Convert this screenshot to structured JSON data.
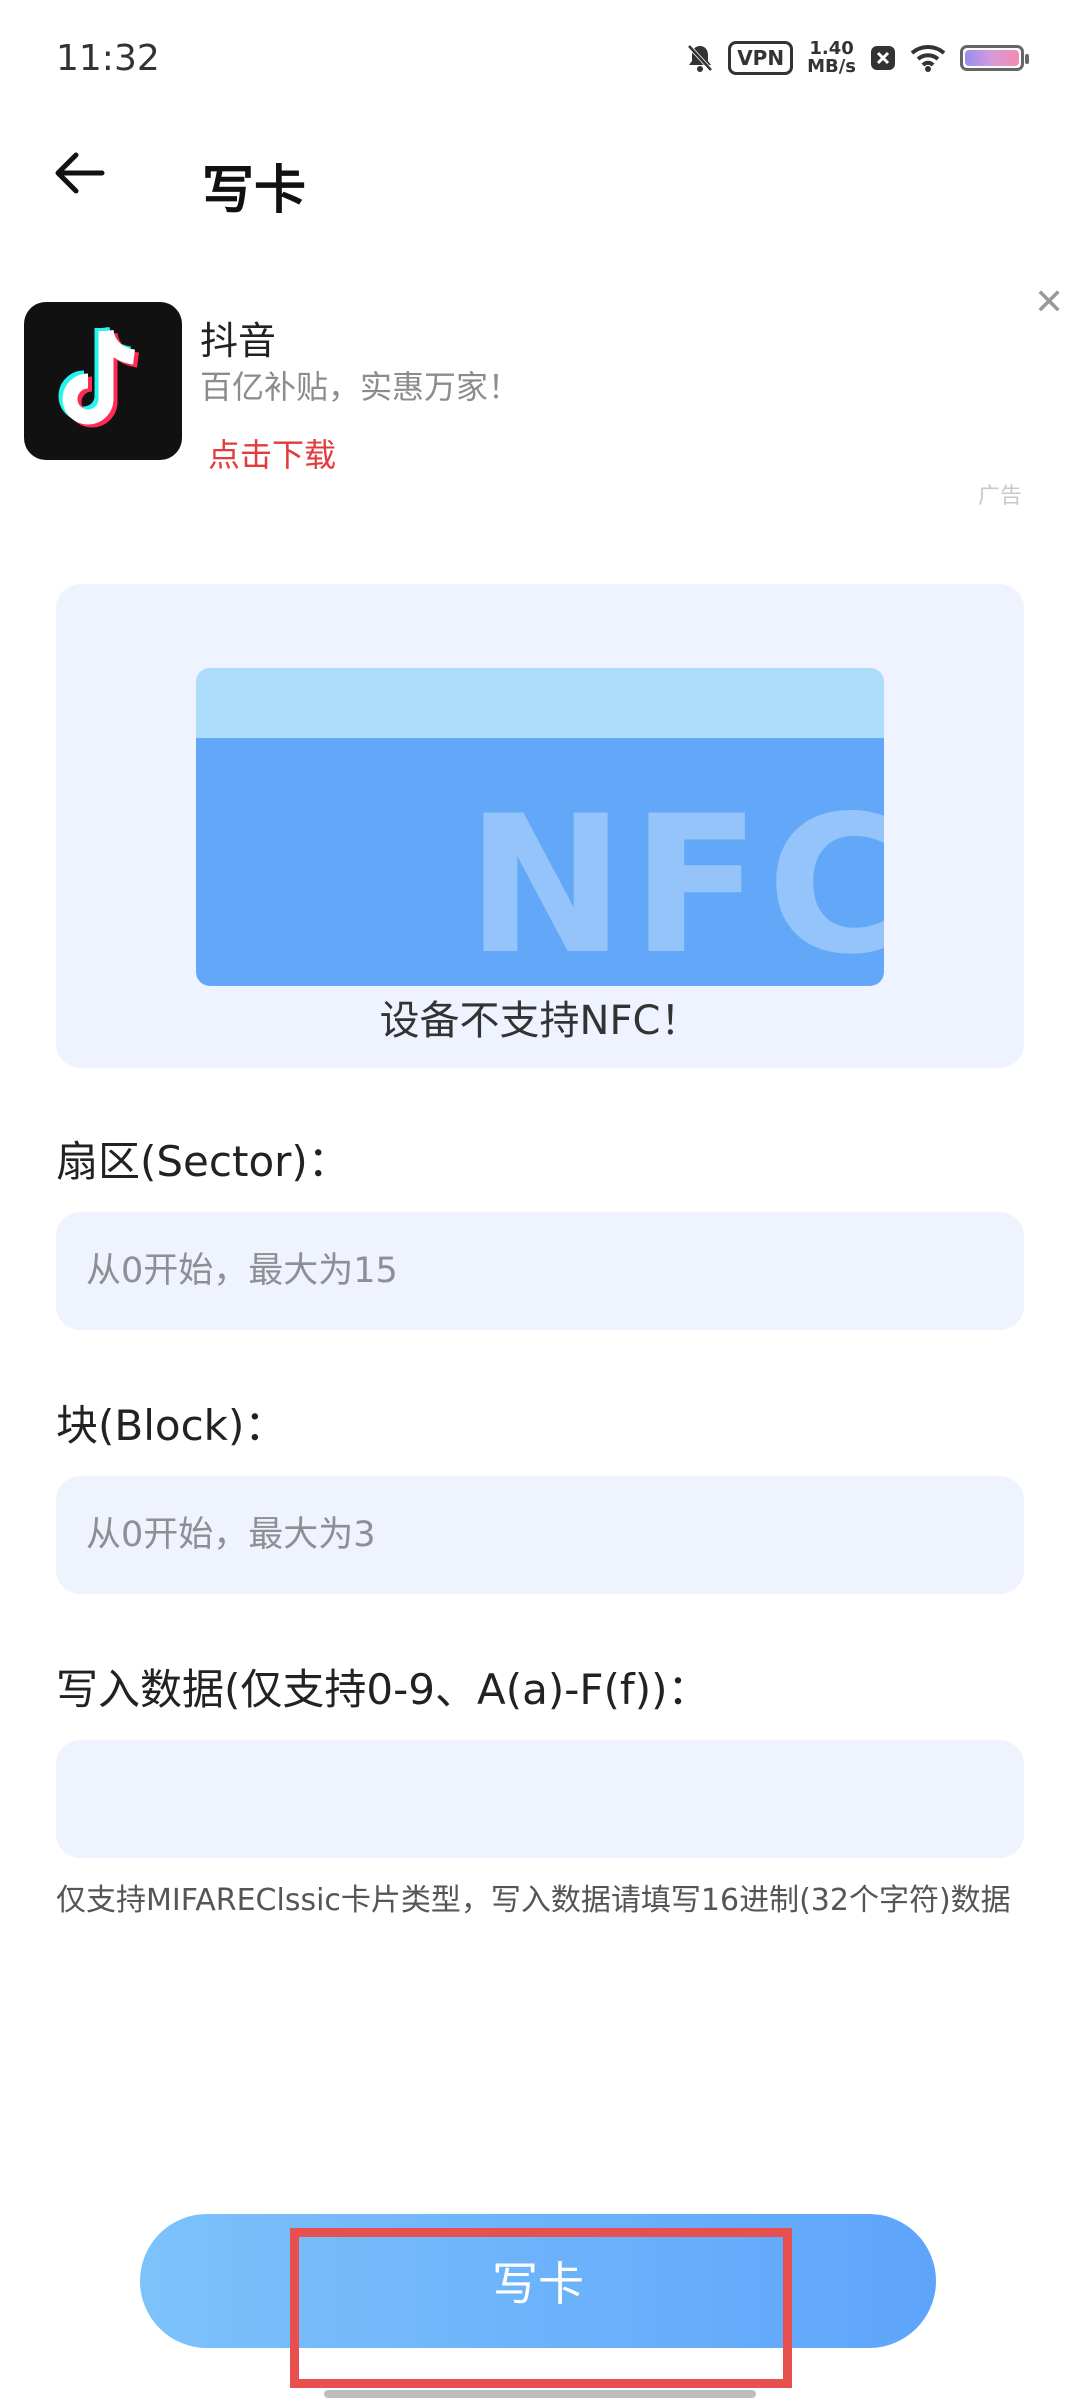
{
  "status_bar": {
    "time": "11:32",
    "vpn": "VPN",
    "speed_value": "1.40",
    "speed_unit": "MB/s",
    "icons": [
      "mute-bell-icon",
      "vpn-icon",
      "close-notification-icon",
      "wifi-icon",
      "battery-icon"
    ]
  },
  "header": {
    "title": "写卡"
  },
  "ad": {
    "app_name": "抖音",
    "subtitle": "百亿补贴，实惠万家！",
    "download_label": "点击下载",
    "close_symbol": "✕",
    "tag": "广告"
  },
  "nfc_card": {
    "illustration_text": "NFC",
    "status": "设备不支持NFC！"
  },
  "form": {
    "sector_label": "扇区(Sector)：",
    "sector_placeholder": "从0开始，最大为15",
    "block_label": "块(Block)：",
    "block_placeholder": "从0开始，最大为3",
    "data_label": "写入数据(仅支持0-9、A(a)-F(f))：",
    "data_placeholder": "",
    "hint": "仅支持MIFAREClssic卡片类型，写入数据请填写16进制(32个字符)数据"
  },
  "actions": {
    "write_button": "写卡"
  },
  "colors": {
    "accent_blue": "#5ea4fb",
    "ad_download_red": "#e33a3a",
    "highlight_red": "#e85050",
    "panel_bg": "#eff3ff"
  }
}
